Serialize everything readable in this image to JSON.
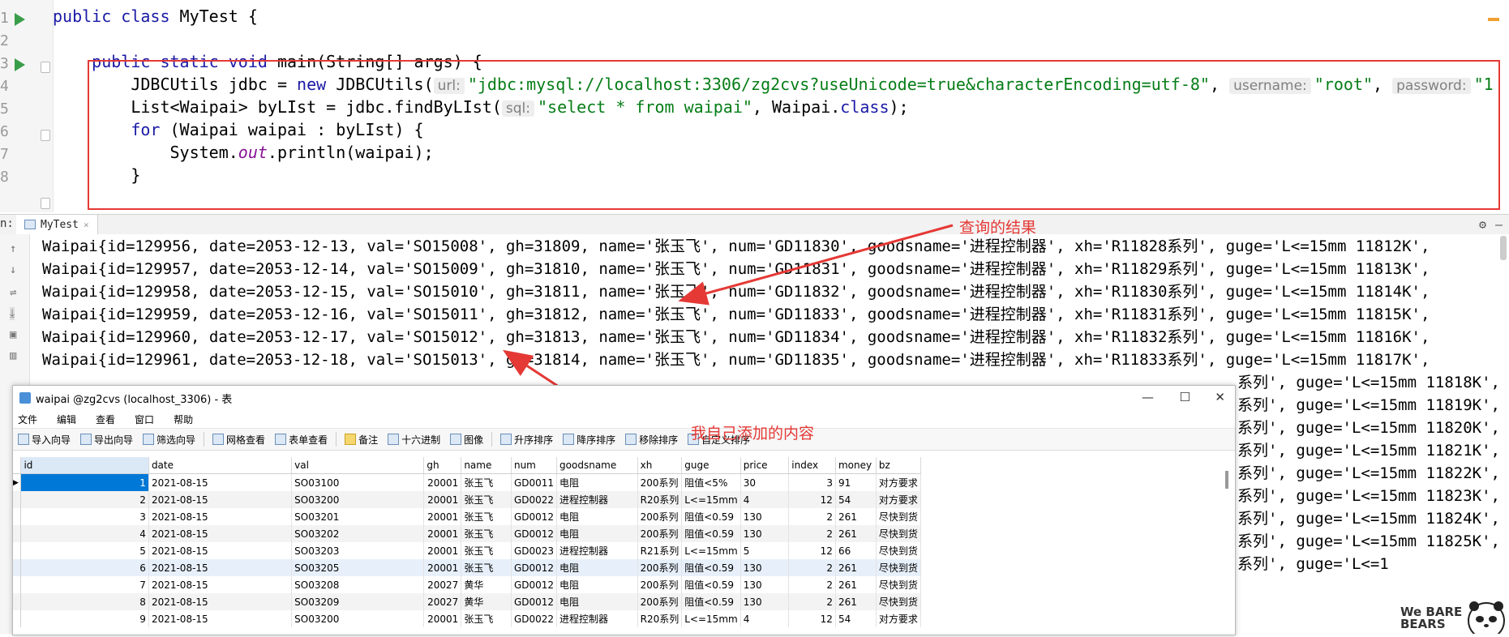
{
  "editor": {
    "lines": [
      {
        "num": "1",
        "tokens": [
          {
            "k": "kw",
            "t": "public class "
          },
          {
            "k": "t",
            "t": "MyTest {"
          }
        ]
      },
      {
        "num": "2",
        "tokens": []
      },
      {
        "num": "3",
        "tokens": [
          {
            "k": "t",
            "t": "    "
          },
          {
            "k": "kw",
            "t": "public static void "
          },
          {
            "k": "t",
            "t": "main(String[] args) {"
          }
        ]
      },
      {
        "num": "4",
        "tokens": [
          {
            "k": "t",
            "t": "        JDBCUtils jdbc = "
          },
          {
            "k": "kw",
            "t": "new "
          },
          {
            "k": "t",
            "t": "JDBCUtils("
          },
          {
            "k": "hint",
            "t": "url:"
          },
          {
            "k": "str",
            "t": "\"jdbc:mysql://localhost:3306/zg2cvs?useUnicode=true&characterEncoding=utf-8\""
          },
          {
            "k": "t",
            "t": ", "
          },
          {
            "k": "hint",
            "t": "username:"
          },
          {
            "k": "str",
            "t": "\"root\""
          },
          {
            "k": "t",
            "t": ", "
          },
          {
            "k": "hint",
            "t": "password:"
          },
          {
            "k": "str",
            "t": "\"1"
          }
        ]
      },
      {
        "num": "5",
        "tokens": [
          {
            "k": "t",
            "t": "        List<Waipai> byLIst = jdbc.findByLIst("
          },
          {
            "k": "hint",
            "t": "sql:"
          },
          {
            "k": "str",
            "t": "\"select * from waipai\""
          },
          {
            "k": "t",
            "t": ", Waipai."
          },
          {
            "k": "kw",
            "t": "class"
          },
          {
            "k": "t",
            "t": ");"
          }
        ]
      },
      {
        "num": "6",
        "tokens": [
          {
            "k": "t",
            "t": "        "
          },
          {
            "k": "kw",
            "t": "for "
          },
          {
            "k": "t",
            "t": "(Waipai waipai : byLIst) {"
          }
        ]
      },
      {
        "num": "7",
        "tokens": [
          {
            "k": "t",
            "t": "            System."
          },
          {
            "k": "fld",
            "t": "out"
          },
          {
            "k": "t",
            "t": ".println(waipai);"
          }
        ]
      },
      {
        "num": "8",
        "tokens": [
          {
            "k": "t",
            "t": "        }"
          }
        ]
      }
    ]
  },
  "run_bar": {
    "prefix": "n:",
    "tab_label": "MyTest",
    "settings_icon": "gear-icon",
    "minimize_icon": "minus-icon"
  },
  "console": {
    "lines": [
      "Waipai{id=129956, date=2053-12-13, val='SO15008', gh=31809, name='张玉飞', num='GD11830', goodsname='进程控制器', xh='R11828系列', guge='L<=15mm 11812K',",
      "Waipai{id=129957, date=2053-12-14, val='SO15009', gh=31810, name='张玉飞', num='GD11831', goodsname='进程控制器', xh='R11829系列', guge='L<=15mm 11813K',",
      "Waipai{id=129958, date=2053-12-15, val='SO15010', gh=31811, name='张玉飞', num='GD11832', goodsname='进程控制器', xh='R11830系列', guge='L<=15mm 11814K',",
      "Waipai{id=129959, date=2053-12-16, val='SO15011', gh=31812, name='张玉飞', num='GD11833', goodsname='进程控制器', xh='R11831系列', guge='L<=15mm 11815K',",
      "Waipai{id=129960, date=2053-12-17, val='SO15012', gh=31813, name='张玉飞', num='GD11834', goodsname='进程控制器', xh='R11832系列', guge='L<=15mm 11816K',",
      "Waipai{id=129961, date=2053-12-18, val='SO15013', gh=31814, name='张玉飞', num='GD11835', goodsname='进程控制器', xh='R11833系列', guge='L<=15mm 11817K',"
    ],
    "tail_lines": [
      "系列', guge='L<=15mm 11818K',",
      "系列', guge='L<=15mm 11819K',",
      "系列', guge='L<=15mm 11820K',",
      "系列', guge='L<=15mm 11821K',",
      "系列', guge='L<=15mm 11822K',",
      "系列', guge='L<=15mm 11823K',",
      "系列', guge='L<=15mm 11824K',",
      "系列', guge='L<=15mm 11825K',",
      "系列', guge='L<=1"
    ]
  },
  "annotations": {
    "query_result": "查询的结果",
    "added_content": "我自己添加的内容"
  },
  "navicat": {
    "title": "waipai @zg2cvs (localhost_3306) - 表",
    "menu": [
      "文件",
      "编辑",
      "查看",
      "窗口",
      "帮助"
    ],
    "toolbar": [
      {
        "label": "导入向导",
        "icon": "import-icon"
      },
      {
        "label": "导出向导",
        "icon": "export-icon"
      },
      {
        "label": "筛选向导",
        "icon": "filter-icon"
      },
      {
        "label": "网格查看",
        "icon": "grid-icon"
      },
      {
        "label": "表单查看",
        "icon": "form-icon"
      },
      {
        "label": "备注",
        "icon": "memo-icon"
      },
      {
        "label": "十六进制",
        "icon": "hex-icon"
      },
      {
        "label": "图像",
        "icon": "image-icon"
      },
      {
        "label": "升序排序",
        "icon": "sort-asc-icon"
      },
      {
        "label": "降序排序",
        "icon": "sort-desc-icon"
      },
      {
        "label": "移除排序",
        "icon": "remove-sort-icon"
      },
      {
        "label": "自定义排序",
        "icon": "custom-sort-icon"
      }
    ],
    "columns": [
      "id",
      "date",
      "val",
      "gh",
      "name",
      "num",
      "goodsname",
      "xh",
      "guge",
      "price",
      "index",
      "money",
      "bz"
    ],
    "rows": [
      [
        "1",
        "2021-08-15",
        "SO03100",
        "20001",
        "张玉飞",
        "GD0011",
        "电阻",
        "200系列",
        "阻值<5%",
        "30",
        "3",
        "91",
        "对方要求"
      ],
      [
        "2",
        "2021-08-15",
        "SO03200",
        "20001",
        "张玉飞",
        "GD0022",
        "进程控制器",
        "R20系列",
        "L<=15mm",
        "4",
        "12",
        "54",
        "对方要求"
      ],
      [
        "3",
        "2021-08-15",
        "SO03201",
        "20001",
        "张玉飞",
        "GD0012",
        "电阻",
        "200系列",
        "阻值<0.59",
        "130",
        "2",
        "261",
        "尽快到货"
      ],
      [
        "4",
        "2021-08-15",
        "SO03202",
        "20001",
        "张玉飞",
        "GD0012",
        "电阻",
        "200系列",
        "阻值<0.59",
        "130",
        "2",
        "261",
        "尽快到货"
      ],
      [
        "5",
        "2021-08-15",
        "SO03203",
        "20001",
        "张玉飞",
        "GD0023",
        "进程控制器",
        "R21系列",
        "L<=15mm",
        "5",
        "12",
        "66",
        "尽快到货"
      ],
      [
        "6",
        "2021-08-15",
        "SO03205",
        "20001",
        "张玉飞",
        "GD0012",
        "电阻",
        "200系列",
        "阻值<0.59",
        "130",
        "2",
        "261",
        "尽快到货"
      ],
      [
        "7",
        "2021-08-15",
        "SO03208",
        "20027",
        "黄华",
        "GD0012",
        "电阻",
        "200系列",
        "阻值<0.59",
        "130",
        "2",
        "261",
        "尽快到货"
      ],
      [
        "8",
        "2021-08-15",
        "SO03209",
        "20027",
        "黄华",
        "GD0012",
        "电阻",
        "200系列",
        "阻值<0.59",
        "130",
        "2",
        "261",
        "尽快到货"
      ],
      [
        "9",
        "2021-08-15",
        "SO03200",
        "20001",
        "张玉飞",
        "GD0022",
        "进程控制器",
        "R20系列",
        "L<=15mm",
        "4",
        "12",
        "54",
        "对方要求"
      ]
    ]
  },
  "mascot": {
    "text": "We BARE BEARS"
  }
}
